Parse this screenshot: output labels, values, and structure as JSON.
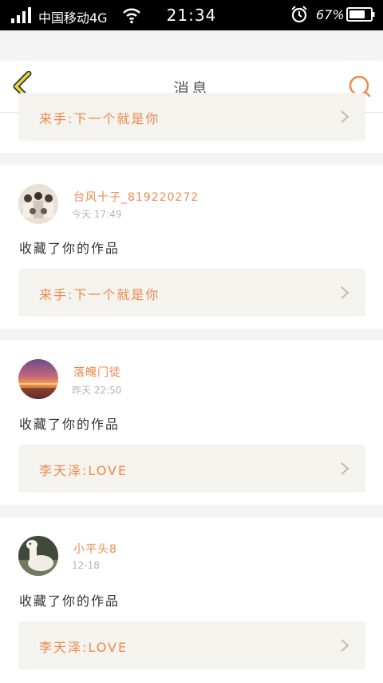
{
  "status_bar": {
    "carrier": "中国移动4G",
    "time": "21:34",
    "battery_percent": "67%"
  },
  "header": {
    "title": "消息",
    "accent_color": "#ec8a4f",
    "back_color": "#e8d63c"
  },
  "messages": [
    {
      "quote": "来手:下一个就是你"
    },
    {
      "username": "台风十子_819220272",
      "time": "今天 17:49",
      "action": "收藏了你的作品",
      "quote": "来手:下一个就是你",
      "avatar": "group-photo"
    },
    {
      "username": "落魄门徒",
      "time": "昨天 22:50",
      "action": "收藏了你的作品",
      "quote": "李天泽:LOVE",
      "avatar": "sunset-photo"
    },
    {
      "username": "小平头8",
      "time": "12-18",
      "action": "收藏了你的作品",
      "quote": "李天泽:LOVE",
      "avatar": "alpaca-photo"
    }
  ]
}
